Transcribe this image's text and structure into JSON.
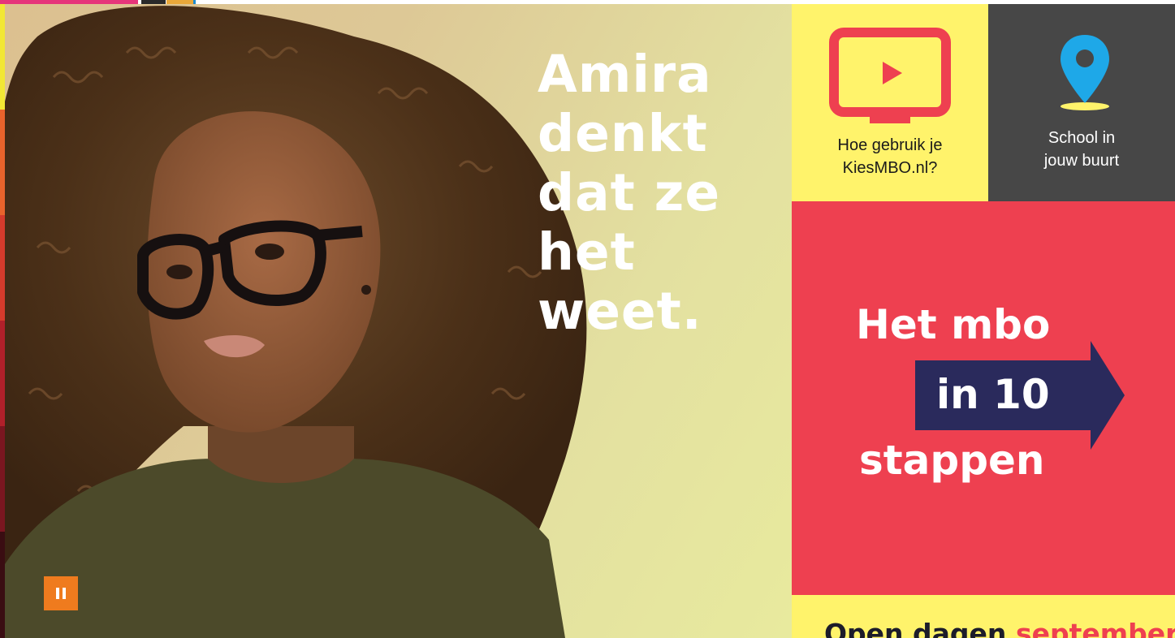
{
  "hero": {
    "title_lines": [
      "Amira",
      "denkt",
      "dat ze",
      "het",
      "weet."
    ],
    "pause_icon": "pause-icon"
  },
  "tiles": {
    "howto": {
      "label_line1": "Hoe gebruik je",
      "label_line2": "KiesMBO.nl?",
      "icon": "video-screen-icon",
      "bg": "#fff36b",
      "accent": "#ee4050"
    },
    "school": {
      "label_line1": "School in",
      "label_line2": "jouw buurt",
      "icon": "location-pin-icon",
      "bg": "#474747",
      "accent": "#1ea8e8"
    },
    "steps": {
      "line1": "Het mbo",
      "line2": "in 10",
      "line3": "stappen",
      "icon": "arrow-right-icon",
      "bg": "#ee4050",
      "arrow_color": "#2a2a5c"
    },
    "open_days": {
      "text_dark": "Open dagen",
      "text_red": "september",
      "bg": "#fff36b"
    }
  },
  "colors": {
    "topbar": [
      "#e6357a",
      "#2a2a2a",
      "#e9a83a",
      "#1d8bd0"
    ],
    "pause_button": "#ef7b1e"
  }
}
